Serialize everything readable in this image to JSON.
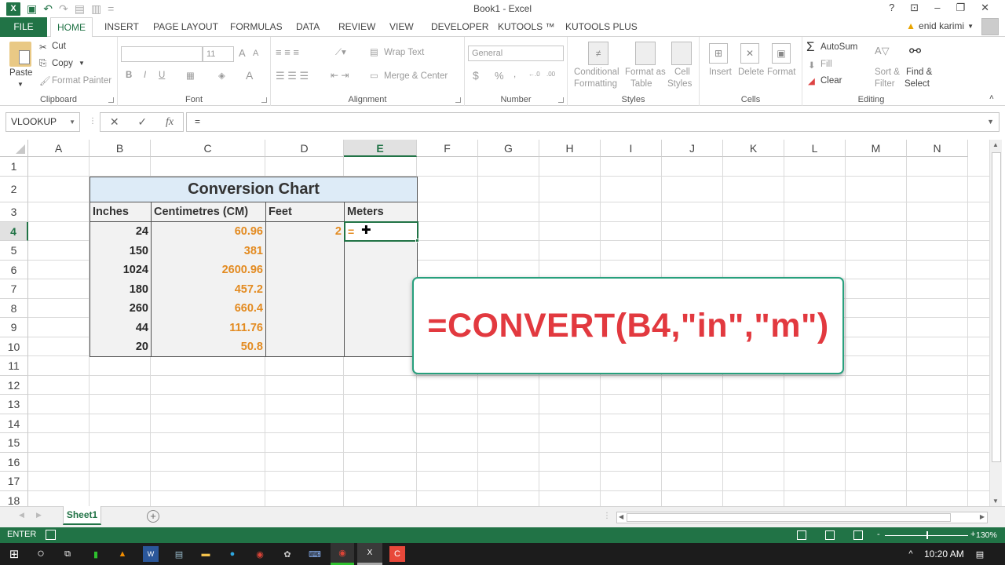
{
  "window": {
    "title": "Book1 - Excel",
    "help": "?",
    "ribbon_display": "⊡",
    "minimize": "–",
    "restore": "🗗",
    "close": "✕"
  },
  "quick_access": {
    "app_icon": "XⅢ",
    "save_icon": "💾",
    "undo_icon": "↶",
    "redo_icon": "↷",
    "customize": "="
  },
  "tabs": [
    {
      "label": "FILE"
    },
    {
      "label": "HOME",
      "active": true
    },
    {
      "label": "INSERT"
    },
    {
      "label": "PAGE LAYOUT"
    },
    {
      "label": "FORMULAS"
    },
    {
      "label": "DATA"
    },
    {
      "label": "REVIEW"
    },
    {
      "label": "VIEW"
    },
    {
      "label": "DEVELOPER"
    },
    {
      "label": "KUTOOLS ™"
    },
    {
      "label": "KUTOOLS PLUS"
    }
  ],
  "user": {
    "name": "enid karimi",
    "warning": "!"
  },
  "ribbon": {
    "clipboard": {
      "label": "Clipboard",
      "paste": "Paste",
      "cut": "Cut",
      "copy": "Copy",
      "format_painter": "Format Painter"
    },
    "font": {
      "label": "Font",
      "font_name": "",
      "font_size": "11",
      "bold": "B",
      "italic": "I",
      "underline": "U",
      "grow": "A˄",
      "shrink": "A˅",
      "font_color": "A"
    },
    "alignment": {
      "label": "Alignment",
      "wrap_text": "Wrap Text",
      "merge_center": "Merge & Center"
    },
    "number": {
      "label": "Number",
      "format": "General",
      "currency": "$",
      "percent": "%",
      "comma": ",",
      "inc_decimal": "←.0",
      "dec_decimal": ".00"
    },
    "styles": {
      "label": "Styles",
      "conditional_1": "Conditional",
      "conditional_2": "Formatting",
      "format_table_1": "Format as",
      "format_table_2": "Table",
      "cell_styles_1": "Cell",
      "cell_styles_2": "Styles"
    },
    "cells": {
      "label": "Cells",
      "insert": "Insert",
      "delete": "Delete",
      "format": "Format"
    },
    "editing": {
      "label": "Editing",
      "autosum": "AutoSum",
      "fill": "Fill",
      "clear": "Clear",
      "sort_1": "Sort &",
      "sort_2": "Filter",
      "find_1": "Find &",
      "find_2": "Select"
    }
  },
  "formula_bar": {
    "name_box": "VLOOKUP",
    "cancel": "✕",
    "enter": "✓",
    "fx": "fx",
    "content": "="
  },
  "columns": [
    "A",
    "B",
    "C",
    "D",
    "E",
    "F",
    "G",
    "H",
    "I",
    "J",
    "K",
    "L",
    "M",
    "N"
  ],
  "selected_column": "E",
  "rows": [
    "1",
    "2",
    "3",
    "4",
    "5",
    "6",
    "7",
    "8",
    "9",
    "10",
    "11",
    "12",
    "13",
    "14",
    "15",
    "16",
    "17",
    "18"
  ],
  "selected_row": "4",
  "sheet": {
    "title": "Conversion Chart",
    "headers": [
      "Inches",
      "Centimetres (CM)",
      "Feet",
      "Meters"
    ],
    "data": [
      {
        "inches": "24",
        "cm": "60.96",
        "feet": "2",
        "meters": "="
      },
      {
        "inches": "150",
        "cm": "381",
        "feet": "",
        "meters": ""
      },
      {
        "inches": "1024",
        "cm": "2600.96",
        "feet": "",
        "meters": ""
      },
      {
        "inches": "180",
        "cm": "457.2",
        "feet": "",
        "meters": ""
      },
      {
        "inches": "260",
        "cm": "660.4",
        "feet": "",
        "meters": ""
      },
      {
        "inches": "44",
        "cm": "111.76",
        "feet": "",
        "meters": ""
      },
      {
        "inches": "20",
        "cm": "50.8",
        "feet": "",
        "meters": ""
      }
    ]
  },
  "callout": {
    "text": "=CONVERT(B4,\"in\",\"m\")"
  },
  "sheet_tabs": [
    {
      "label": "Sheet1",
      "active": true
    }
  ],
  "add_sheet": "+",
  "status_bar": {
    "mode": "ENTER",
    "zoom": "130%"
  },
  "taskbar": {
    "time": "10:20 AM"
  },
  "colors": {
    "excel_green": "#217346",
    "accent_orange": "#e38b21",
    "callout_red": "#e2393f",
    "callout_border": "#27a07d",
    "title_fill": "#ddebf7"
  }
}
